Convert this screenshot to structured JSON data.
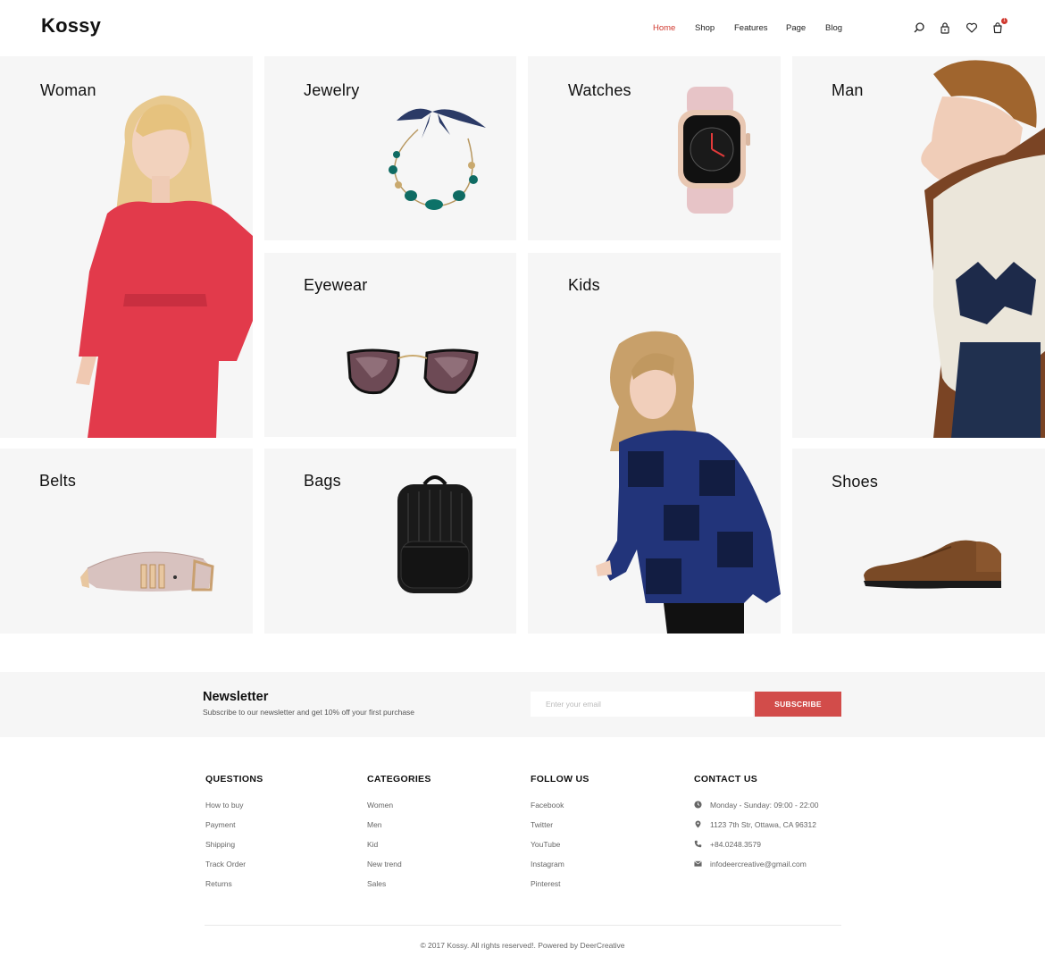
{
  "brand": {
    "logo": "Kossy"
  },
  "nav": {
    "items": [
      {
        "label": "Home",
        "active": true
      },
      {
        "label": "Shop"
      },
      {
        "label": "Features"
      },
      {
        "label": "Page"
      },
      {
        "label": "Blog"
      }
    ],
    "cart_count": "1"
  },
  "header_icons": [
    "search-icon",
    "lock-icon",
    "heart-icon",
    "cart-icon"
  ],
  "categories": {
    "woman": "Woman",
    "jewelry": "Jewelry",
    "watches": "Watches",
    "man": "Man",
    "eyewear": "Eyewear",
    "kids": "Kids",
    "belts": "Belts",
    "bags": "Bags",
    "shoes": "Shoes"
  },
  "newsletter": {
    "title": "Newsletter",
    "subtitle": "Subscribe to our newsletter and get 10% off your first purchase",
    "placeholder": "Enter your email",
    "button": "SUBSCRIBE"
  },
  "footer": {
    "questions": {
      "title": "QUESTIONS",
      "items": [
        "How to buy",
        "Payment",
        "Shipping",
        "Track Order",
        "Returns"
      ]
    },
    "categories": {
      "title": "CATEGORIES",
      "items": [
        "Women",
        "Men",
        "Kid",
        "New trend",
        "Sales"
      ]
    },
    "follow": {
      "title": "FOLLOW US",
      "items": [
        "Facebook",
        "Twitter",
        "YouTube",
        "Instagram",
        "Pinterest"
      ]
    },
    "contact": {
      "title": "CONTACT US",
      "items": [
        {
          "icon": "clock-icon",
          "text": "Monday - Sunday: 09:00 - 22:00"
        },
        {
          "icon": "location-pin-icon",
          "text": "1123 7th Str, Ottawa, CA 96312"
        },
        {
          "icon": "phone-icon",
          "text": "+84.0248.3579"
        },
        {
          "icon": "mail-icon",
          "text": "infodeercreative@gmail.com"
        }
      ]
    },
    "copyright": "© 2017 Kossy. All rights reserved!. Powered by DeerCreative"
  },
  "colors": {
    "accent": "#d0382e",
    "button": "#d24c4a",
    "tile_bg": "#f6f6f6"
  }
}
